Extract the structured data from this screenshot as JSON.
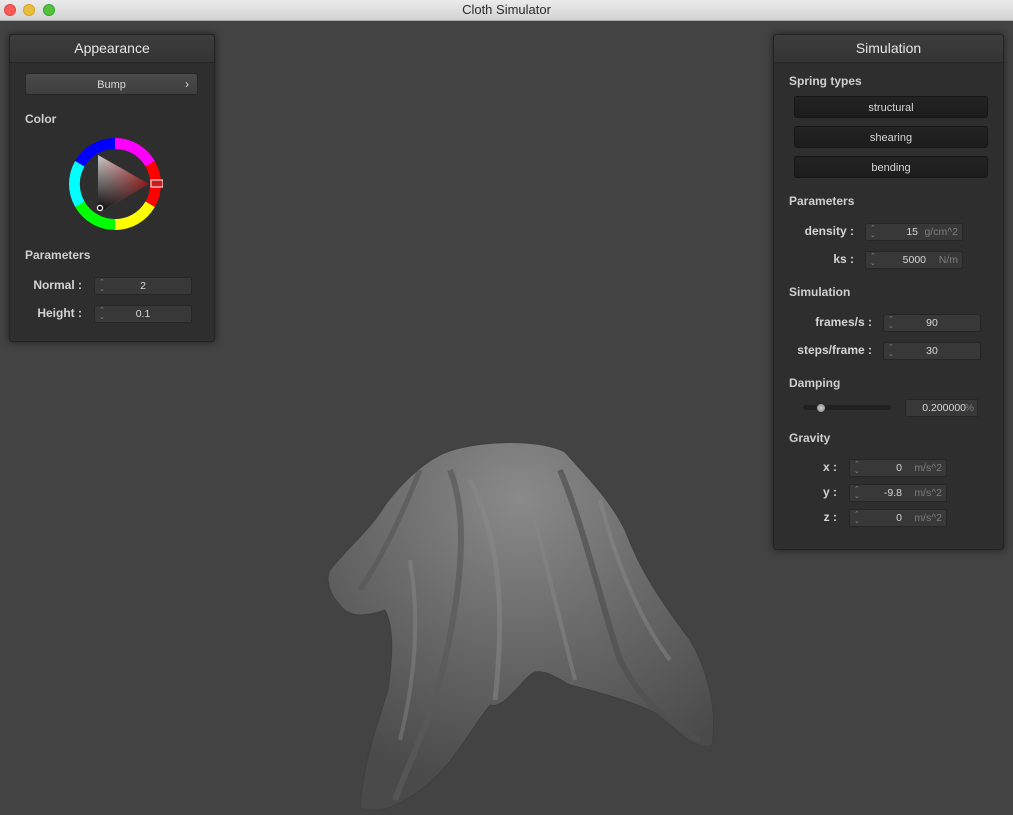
{
  "window": {
    "title": "Cloth Simulator"
  },
  "appearance": {
    "header": "Appearance",
    "shader_button": "Bump",
    "shader_chevron": "›",
    "color_label": "Color",
    "params_label": "Parameters",
    "normal": {
      "label": "Normal :",
      "value": "2"
    },
    "height": {
      "label": "Height :",
      "value": "0.1"
    }
  },
  "simulation": {
    "header": "Simulation",
    "spring_types_label": "Spring types",
    "springs": [
      "structural",
      "shearing",
      "bending"
    ],
    "params_label": "Parameters",
    "density": {
      "label": "density :",
      "value": "15",
      "unit": "g/cm^2"
    },
    "ks": {
      "label": "ks :",
      "value": "5000",
      "unit": "N/m"
    },
    "sim_label": "Simulation",
    "fps": {
      "label": "frames/s :",
      "value": "90"
    },
    "steps": {
      "label": "steps/frame :",
      "value": "30"
    },
    "damping_label": "Damping",
    "damping": {
      "value": "0.200000",
      "unit": "%",
      "slider_fraction": 0.2
    },
    "gravity_label": "Gravity",
    "gx": {
      "label": "x :",
      "value": "0",
      "unit": "m/s^2"
    },
    "gy": {
      "label": "y :",
      "value": "-9.8",
      "unit": "m/s^2"
    },
    "gz": {
      "label": "z :",
      "value": "0",
      "unit": "m/s^2"
    }
  },
  "colors": {
    "background": "#434343",
    "panel": "#2e2e2e",
    "selected_color": "#c81e1e",
    "cloth": "#6e6e6e"
  }
}
